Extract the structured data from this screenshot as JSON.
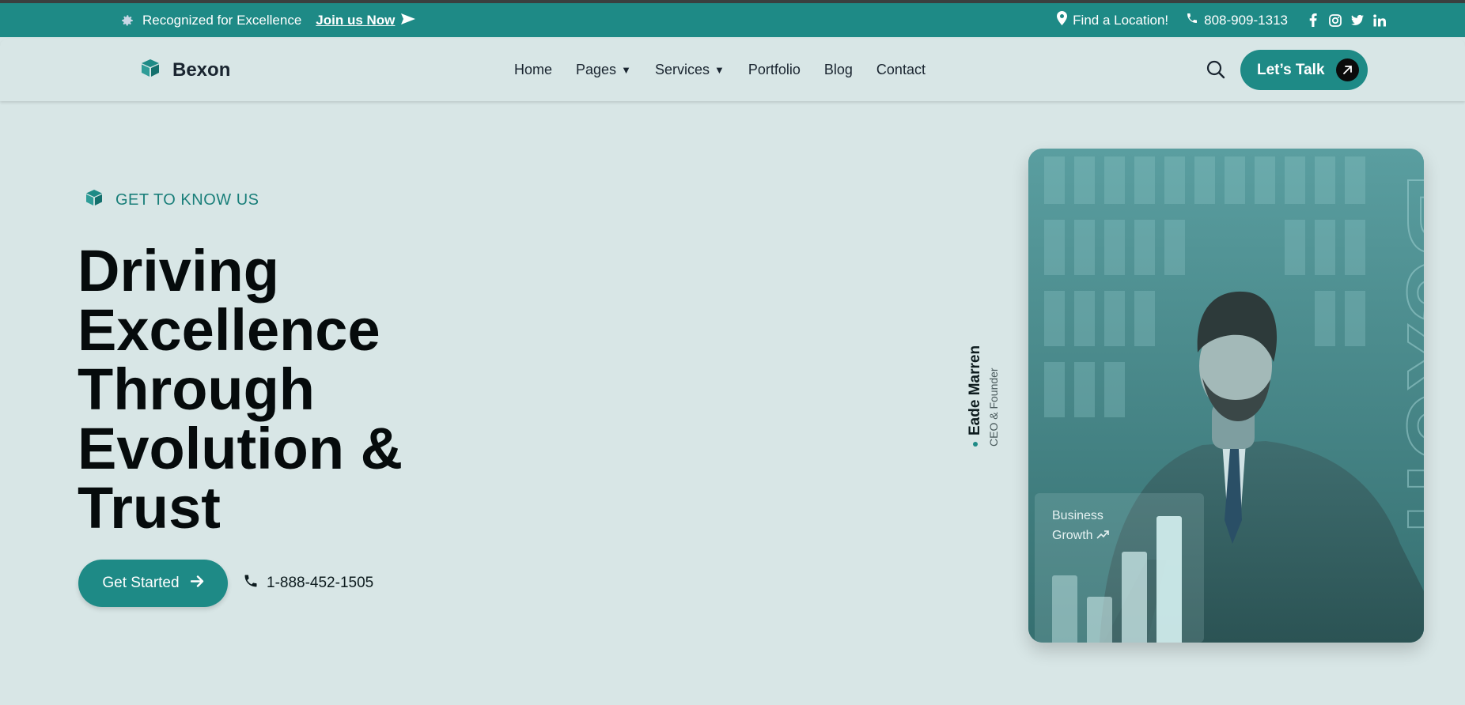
{
  "topbar": {
    "recognition_text": "Recognized for Excellence",
    "join_label": "Join us Now",
    "location_label": "Find a Location!",
    "phone": "808-909-1313",
    "socials": [
      "facebook-icon",
      "instagram-icon",
      "twitter-icon",
      "linkedin-icon"
    ]
  },
  "header": {
    "brand": "Bexon",
    "nav": [
      {
        "label": "Home",
        "has_dropdown": false
      },
      {
        "label": "Pages",
        "has_dropdown": true
      },
      {
        "label": "Services",
        "has_dropdown": true
      },
      {
        "label": "Portfolio",
        "has_dropdown": false
      },
      {
        "label": "Blog",
        "has_dropdown": false
      },
      {
        "label": "Contact",
        "has_dropdown": false
      }
    ],
    "cta_label": "Let’s Talk"
  },
  "hero": {
    "eyebrow": "GET TO KNOW US",
    "headline_lines": [
      "Driving",
      "Excellence",
      "Through",
      "Evolution &",
      "Trust"
    ],
    "cta_label": "Get Started",
    "phone": "1-888-452-1505",
    "founder_name": "Eade Marren",
    "founder_role": "CEO & Founder",
    "card_watermark": "Bexon",
    "growth_label_line1": "Business",
    "growth_label_line2": "Growth"
  },
  "colors": {
    "accent": "#1e8a86",
    "background": "#d8e6e6",
    "text_dark": "#060b0c"
  }
}
